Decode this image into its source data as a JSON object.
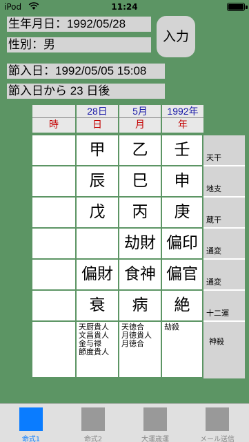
{
  "status": {
    "carrier": "iPod",
    "time": "11:24"
  },
  "info": {
    "birth": "生年月日：1992/05/28",
    "gender": "性別：男",
    "setsu": "節入日：1992/05/05 15:08",
    "after": "節入日から 23 日後"
  },
  "input_button": "入力",
  "headers": {
    "top": [
      "28日",
      "5月",
      "1992年"
    ],
    "bottom": [
      "時",
      "日",
      "月",
      "年"
    ]
  },
  "rows": [
    {
      "cells": [
        "",
        "甲",
        "乙",
        "壬"
      ],
      "label": "天干"
    },
    {
      "cells": [
        "",
        "辰",
        "巳",
        "申"
      ],
      "label": "地支"
    },
    {
      "cells": [
        "",
        "戊",
        "丙",
        "庚"
      ],
      "label": "蔵干"
    },
    {
      "cells": [
        "",
        "",
        "劫財",
        "偏印"
      ],
      "label": "通変"
    },
    {
      "cells": [
        "",
        "偏財",
        "食神",
        "偏官"
      ],
      "label": "通変"
    },
    {
      "cells": [
        "",
        "衰",
        "病",
        "絶"
      ],
      "label": "十二運"
    }
  ],
  "shinsatsu": {
    "cells": [
      "",
      "天厨貴人\n文昌貴人\n金与禄\n節度貴人",
      "天徳合\n月徳貴人\n月徳合",
      "劫殺"
    ],
    "label": "神殺"
  },
  "tabs": [
    {
      "label": "命式1",
      "icon": "square-icon",
      "active": true
    },
    {
      "label": "命式2",
      "icon": "square-icon",
      "active": false
    },
    {
      "label": "大運歳運",
      "icon": "square-icon",
      "active": false
    },
    {
      "label": "メール送信",
      "icon": "square-icon",
      "active": false
    }
  ],
  "colors": {
    "background": "#5c9564",
    "accent": "#0a7cff",
    "header_blue": "#1a1aa8",
    "header_red": "#c40000"
  }
}
